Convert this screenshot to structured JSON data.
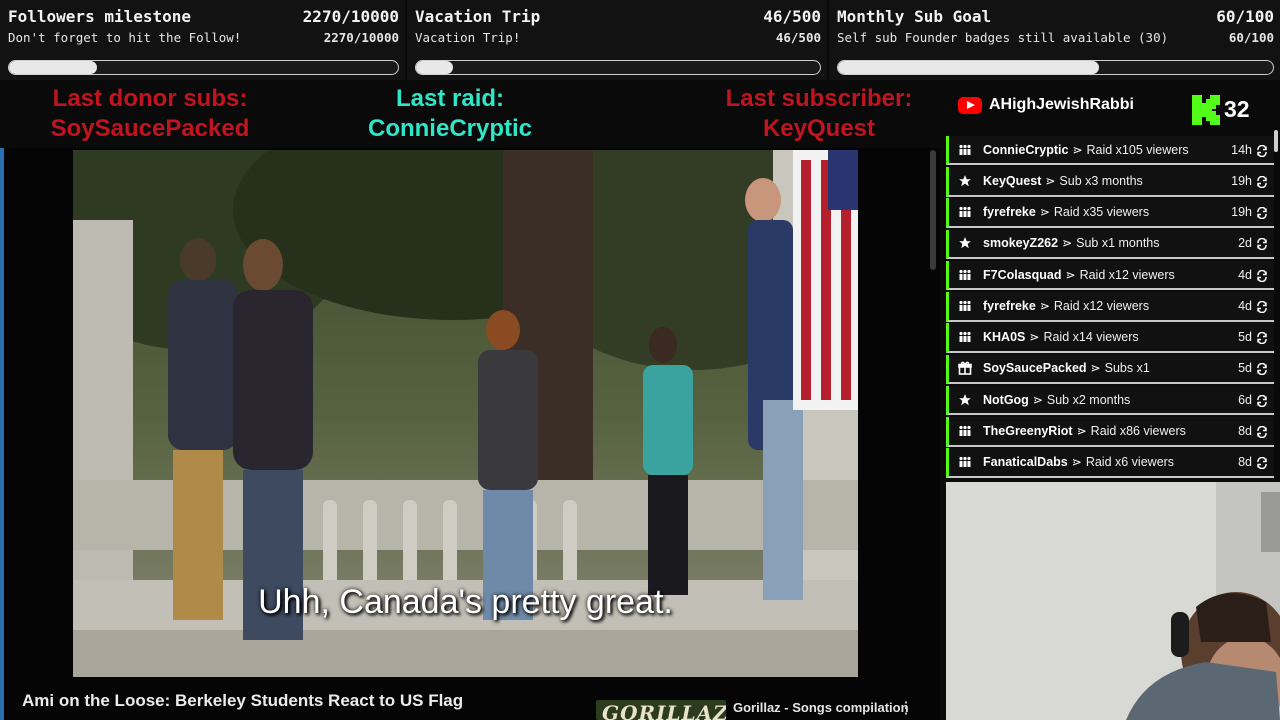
{
  "goals": [
    {
      "title": "Followers milestone",
      "count": "2270/10000",
      "subtitle": "Don't forget to hit the Follow!",
      "sub_count": "2270/10000",
      "progress": 0.227
    },
    {
      "title": "Vacation Trip",
      "count": "46/500",
      "subtitle": "Vacation Trip!",
      "sub_count": "46/500",
      "progress": 0.092
    },
    {
      "title": "Monthly Sub Goal",
      "count": "60/100",
      "subtitle": "Self sub Founder badges still available (30)",
      "sub_count": "60/100",
      "progress": 0.6
    }
  ],
  "last_labels": [
    {
      "label": "Last donor subs:",
      "value": "SoySaucePacked",
      "color": "#c0141e"
    },
    {
      "label": "Last raid:",
      "value": "ConnieCryptic",
      "color": "#2ee6c8"
    },
    {
      "label": "Last subscriber:",
      "value": "KeyQuest",
      "color": "#c0141e"
    }
  ],
  "video": {
    "subtitle": "Uhh, Canada's pretty great.",
    "title": "Ami on the Loose: Berkeley Students React to US Flag",
    "up_next_thumb_text": "GORILLAZ",
    "up_next_title": "Gorillaz - Songs compilation",
    "more_icon": "more-vert-icon"
  },
  "channel": {
    "name": "AHighJewishRabbi",
    "platform_icon": "youtube-icon",
    "kick_icon": "kick-icon",
    "viewer_count": "32"
  },
  "colors": {
    "accent_green": "#53fc18",
    "youtube_red": "#ff0000"
  },
  "events": [
    {
      "icon": "raid-icon",
      "name": "ConnieCryptic",
      "sep": "⋗",
      "text": "Raid x105 viewers",
      "time": "14h"
    },
    {
      "icon": "star-icon",
      "name": "KeyQuest",
      "sep": "⋗",
      "text": "Sub x3 months",
      "time": "19h"
    },
    {
      "icon": "raid-icon",
      "name": "fyrefreke",
      "sep": "⋗",
      "text": "Raid x35 viewers",
      "time": "19h"
    },
    {
      "icon": "star-icon",
      "name": "smokeyZ262",
      "sep": "⋗",
      "text": "Sub x1 months",
      "time": "2d"
    },
    {
      "icon": "raid-icon",
      "name": "F7Colasquad",
      "sep": "⋗",
      "text": "Raid x12 viewers",
      "time": "4d"
    },
    {
      "icon": "raid-icon",
      "name": "fyrefreke",
      "sep": "⋗",
      "text": "Raid x12 viewers",
      "time": "4d"
    },
    {
      "icon": "raid-icon",
      "name": "KHA0S",
      "sep": "⋗",
      "text": "Raid x14 viewers",
      "time": "5d"
    },
    {
      "icon": "gift-icon",
      "name": "SoySaucePacked",
      "sep": "⋗",
      "text": "Subs x1",
      "time": "5d"
    },
    {
      "icon": "star-icon",
      "name": "NotGog",
      "sep": "⋗",
      "text": "Sub x2 months",
      "time": "6d"
    },
    {
      "icon": "raid-icon",
      "name": "TheGreenyRiot",
      "sep": "⋗",
      "text": "Raid x86 viewers",
      "time": "8d"
    },
    {
      "icon": "raid-icon",
      "name": "FanaticalDabs",
      "sep": "⋗",
      "text": "Raid x6 viewers",
      "time": "8d"
    }
  ]
}
